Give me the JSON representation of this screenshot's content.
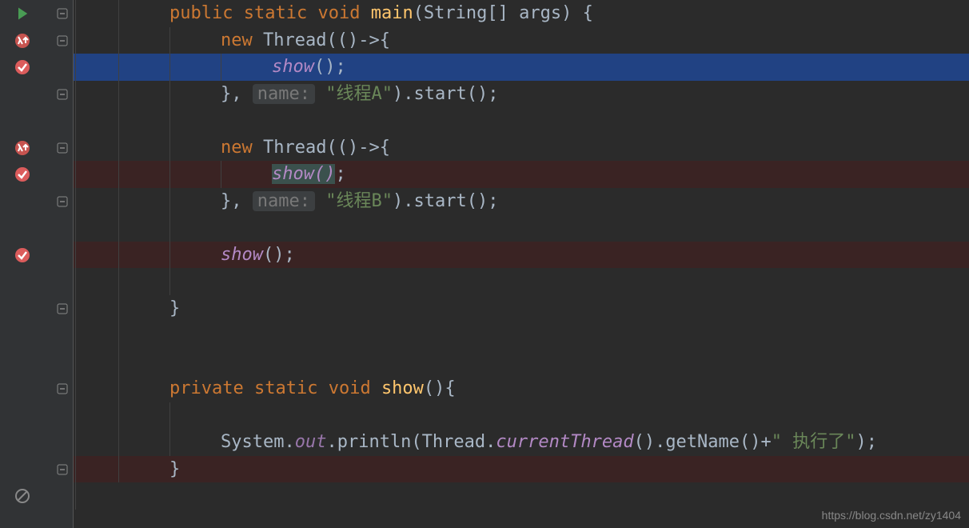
{
  "code": {
    "lines": [
      {
        "indent": 2,
        "tokens": [
          {
            "t": "public",
            "c": "kw"
          },
          {
            "t": " ",
            "c": ""
          },
          {
            "t": "static",
            "c": "kw"
          },
          {
            "t": " ",
            "c": ""
          },
          {
            "t": "void",
            "c": "kw"
          },
          {
            "t": " ",
            "c": ""
          },
          {
            "t": "main",
            "c": "fn"
          },
          {
            "t": "(String[] args) {",
            "c": ""
          }
        ],
        "gutter": "run",
        "fold": "minus",
        "bg": "",
        "ig": [
          0,
          1
        ]
      },
      {
        "indent": 3,
        "tokens": [
          {
            "t": "new",
            "c": "kw"
          },
          {
            "t": " Thread(()->{",
            "c": ""
          }
        ],
        "gutter": "lambda",
        "fold": "minus",
        "bg": "",
        "ig": [
          0,
          1,
          2
        ]
      },
      {
        "indent": 4,
        "tokens": [
          {
            "t": "show",
            "c": "ital"
          },
          {
            "t": "();",
            "c": ""
          }
        ],
        "gutter": "bp",
        "fold": "",
        "bg": "hl",
        "ig": [
          0,
          1,
          2,
          3
        ]
      },
      {
        "indent": 3,
        "tokens": [
          {
            "t": "}, ",
            "c": ""
          },
          {
            "t": "name:",
            "c": "hint"
          },
          {
            "t": " ",
            "c": ""
          },
          {
            "t": "\"线程A\"",
            "c": "str"
          },
          {
            "t": ").start();",
            "c": ""
          }
        ],
        "gutter": "",
        "fold": "minus",
        "bg": "",
        "ig": [
          0,
          1,
          2
        ]
      },
      {
        "indent": 0,
        "tokens": [],
        "gutter": "",
        "fold": "",
        "bg": "",
        "ig": [
          0,
          1,
          2
        ]
      },
      {
        "indent": 3,
        "tokens": [
          {
            "t": "new",
            "c": "kw"
          },
          {
            "t": " Thread(()->{",
            "c": ""
          }
        ],
        "gutter": "lambda",
        "fold": "minus",
        "bg": "",
        "ig": [
          0,
          1,
          2
        ]
      },
      {
        "indent": 4,
        "tokens": [
          {
            "t": "show()",
            "c": "ital paren-hl"
          },
          {
            "t": ";",
            "c": ""
          }
        ],
        "gutter": "bp",
        "fold": "",
        "bg": "bp",
        "ig": [
          0,
          1,
          2,
          3
        ]
      },
      {
        "indent": 3,
        "tokens": [
          {
            "t": "}, ",
            "c": ""
          },
          {
            "t": "name:",
            "c": "hint"
          },
          {
            "t": " ",
            "c": ""
          },
          {
            "t": "\"线程B\"",
            "c": "str"
          },
          {
            "t": ").start();",
            "c": ""
          }
        ],
        "gutter": "",
        "fold": "minus",
        "bg": "",
        "ig": [
          0,
          1,
          2
        ]
      },
      {
        "indent": 0,
        "tokens": [],
        "gutter": "",
        "fold": "",
        "bg": "",
        "ig": [
          0,
          1,
          2
        ]
      },
      {
        "indent": 3,
        "tokens": [
          {
            "t": "show",
            "c": "ital"
          },
          {
            "t": "();",
            "c": ""
          }
        ],
        "gutter": "bp",
        "fold": "",
        "bg": "bp",
        "ig": [
          0,
          1,
          2
        ]
      },
      {
        "indent": 0,
        "tokens": [],
        "gutter": "",
        "fold": "",
        "bg": "",
        "ig": [
          0,
          1,
          2
        ]
      },
      {
        "indent": 2,
        "tokens": [
          {
            "t": "}",
            "c": ""
          }
        ],
        "gutter": "",
        "fold": "minus",
        "bg": "",
        "ig": [
          0,
          1
        ]
      },
      {
        "indent": 0,
        "tokens": [],
        "gutter": "",
        "fold": "",
        "bg": "",
        "ig": [
          0,
          1
        ]
      },
      {
        "indent": 0,
        "tokens": [],
        "gutter": "",
        "fold": "",
        "bg": "",
        "ig": [
          0,
          1
        ]
      },
      {
        "indent": 2,
        "tokens": [
          {
            "t": "private",
            "c": "kw"
          },
          {
            "t": " ",
            "c": ""
          },
          {
            "t": "static",
            "c": "kw"
          },
          {
            "t": " ",
            "c": ""
          },
          {
            "t": "void",
            "c": "kw"
          },
          {
            "t": " ",
            "c": ""
          },
          {
            "t": "show",
            "c": "fn"
          },
          {
            "t": "(){",
            "c": ""
          }
        ],
        "gutter": "",
        "fold": "minus",
        "bg": "",
        "ig": [
          0,
          1
        ]
      },
      {
        "indent": 0,
        "tokens": [],
        "gutter": "",
        "fold": "",
        "bg": "",
        "ig": [
          0,
          1,
          2
        ]
      },
      {
        "indent": 3,
        "tokens": [
          {
            "t": "System.",
            "c": ""
          },
          {
            "t": "out",
            "c": "ital2"
          },
          {
            "t": ".println(Thread.",
            "c": ""
          },
          {
            "t": "currentThread",
            "c": "ital"
          },
          {
            "t": "().getName()+",
            "c": ""
          },
          {
            "t": "\" 执行了\"",
            "c": "str"
          },
          {
            "t": ");",
            "c": ""
          }
        ],
        "gutter": "",
        "fold": "",
        "bg": "",
        "ig": [
          0,
          1,
          2
        ]
      },
      {
        "indent": 2,
        "tokens": [
          {
            "t": "}",
            "c": ""
          }
        ],
        "gutter": "",
        "fold": "minus",
        "bg": "bp",
        "ig": [
          0,
          1
        ]
      },
      {
        "indent": 0,
        "tokens": [],
        "gutter": "block",
        "fold": "",
        "bg": "",
        "ig": [
          0
        ]
      }
    ]
  },
  "watermark": "https://blog.csdn.net/zy1404",
  "icons": {
    "run": "run-icon",
    "lambda": "lambda-up-icon",
    "bp": "breakpoint-icon",
    "block": "block-icon"
  },
  "indentWidth": 32,
  "baseIndent": 56
}
